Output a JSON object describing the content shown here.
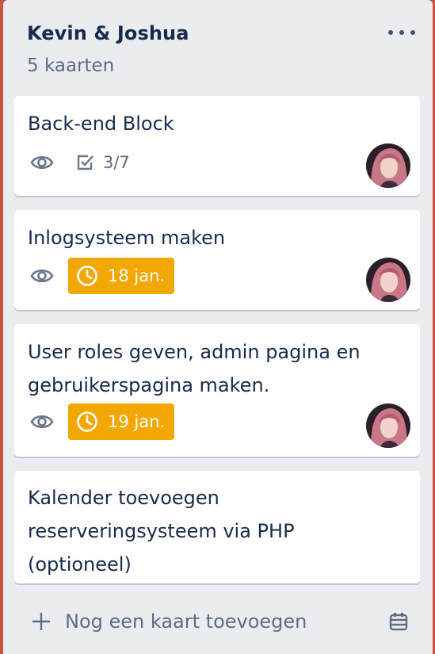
{
  "list": {
    "title": "Kevin & Joshua",
    "count": "5 kaarten",
    "menu_icon": "more-horizontal-icon"
  },
  "cards": [
    {
      "title": "Back-end Block",
      "checklist": "3/7",
      "watching": true,
      "avatar": "member-avatar"
    },
    {
      "title": "Inlogsysteem maken",
      "due": "18 jan.",
      "due_color": "#f2a800",
      "watching": true,
      "avatar": "member-avatar"
    },
    {
      "title": "User roles geven, admin pagina en gebruikerspagina maken.",
      "due": "19 jan.",
      "due_color": "#f2a800",
      "watching": true,
      "avatar": "member-avatar"
    },
    {
      "title": "Kalender toevoegen reserveringsysteem via PHP (optioneel)"
    }
  ],
  "footer": {
    "add_card_label": "Nog een kaart toevoegen",
    "add_icon": "plus-icon",
    "template_icon": "card-template-icon"
  },
  "colors": {
    "board_background": "#c7563f",
    "list_background": "#ebecf0",
    "due_soon": "#f2a800",
    "text_primary": "#172b4d",
    "text_secondary": "#5e6c84"
  }
}
